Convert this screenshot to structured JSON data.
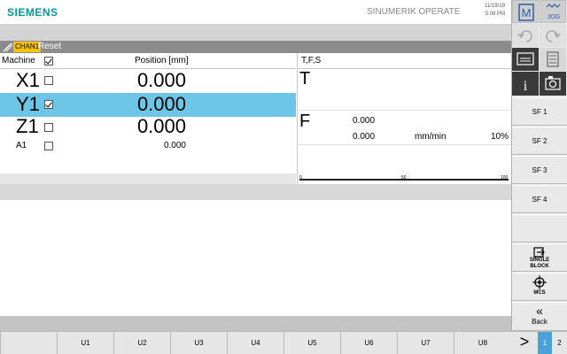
{
  "header": {
    "brand": "SIEMENS",
    "app_title": "SINUMERIK OPERATE",
    "date": "11/19/19",
    "time": "5:08 PM"
  },
  "channel": {
    "name": "CHAN1",
    "state": "Reset"
  },
  "position_table": {
    "col_coordinate": "Machine",
    "col_position": "Position [mm]",
    "header_checked": true,
    "rows": [
      {
        "axis": "X1",
        "checked": false,
        "value": "0.000",
        "selected": false
      },
      {
        "axis": "Y1",
        "checked": true,
        "value": "0.000",
        "selected": true
      },
      {
        "axis": "Z1",
        "checked": false,
        "value": "0.000",
        "selected": false
      },
      {
        "axis": "A1",
        "checked": false,
        "value": "0.000",
        "selected": false
      }
    ]
  },
  "tfs": {
    "title": "T,F,S",
    "t_label": "T",
    "f_label": "F",
    "f_value": "0.000",
    "f_actual": "0.000",
    "f_unit": "mm/min",
    "f_override": "10%",
    "scale_labels": [
      "0",
      "50",
      "100"
    ]
  },
  "side_icons": {
    "machine_key": "M",
    "jog_label": "JOG"
  },
  "softkeys_vertical": [
    {
      "label": "SF 1"
    },
    {
      "label": "SF 2"
    },
    {
      "label": "SF 3"
    },
    {
      "label": "SF 4"
    },
    {
      "label": "SINGLE BLOCK",
      "icon": "single-block-icon"
    },
    {
      "label": "MCS",
      "icon": "crosshair-icon"
    },
    {
      "label": "Back",
      "icon": "double-chevron-left-icon"
    }
  ],
  "softkeys_horizontal": [
    "U1",
    "U2",
    "U3",
    "U4",
    "U5",
    "U6",
    "U7",
    "U8"
  ],
  "pager": {
    "more": ">",
    "page_1": "1",
    "page_2": "2"
  },
  "colors": {
    "brand": "#009999",
    "selected_row": "#6ec6e6",
    "channel_badge": "#f5c400",
    "active_page": "#4aa3d8"
  }
}
